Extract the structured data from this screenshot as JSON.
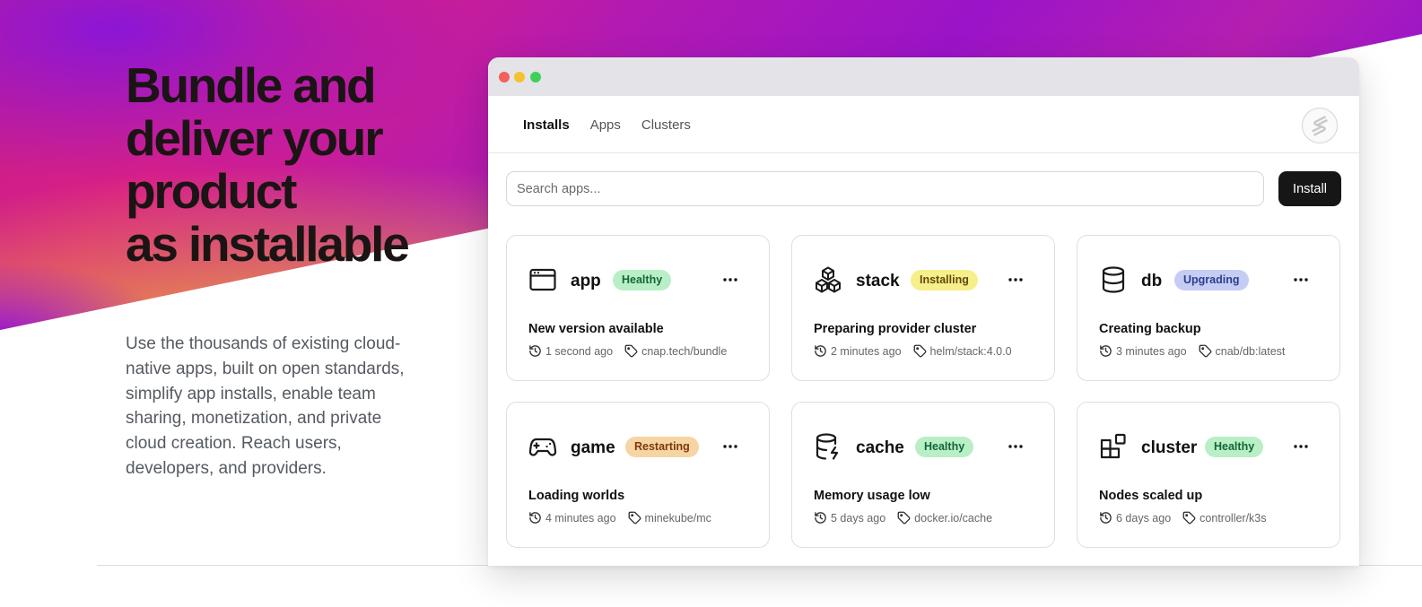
{
  "hero": {
    "title_lines": [
      "Bundle and",
      "deliver your",
      "product",
      "as installable"
    ],
    "description": "Use the thousands of existing cloud-native apps, built on open standards, simplify app installs, enable team sharing, monetization, and private cloud creation. Reach users, developers, and providers."
  },
  "nav": {
    "tabs": [
      {
        "label": "Installs",
        "active": true
      },
      {
        "label": "Apps",
        "active": false
      },
      {
        "label": "Clusters",
        "active": false
      }
    ],
    "avatar_icon": "logo-s-icon"
  },
  "search": {
    "placeholder": "Search apps...",
    "value": ""
  },
  "install_button": {
    "label": "Install"
  },
  "cards": [
    {
      "name": "app",
      "icon": "browser-window-icon",
      "badge": "Healthy",
      "status": "New version available",
      "time": "1 second ago",
      "tag": "cnap.tech/bundle"
    },
    {
      "name": "stack",
      "icon": "cubes-stack-icon",
      "badge": "Installing",
      "status": "Preparing provider cluster",
      "time": "2 minutes ago",
      "tag": "helm/stack:4.0.0"
    },
    {
      "name": "db",
      "icon": "database-icon",
      "badge": "Upgrading",
      "status": "Creating backup",
      "time": "3 minutes ago",
      "tag": "cnab/db:latest"
    },
    {
      "name": "game",
      "icon": "gamepad-icon",
      "badge": "Restarting",
      "status": "Loading worlds",
      "time": "4 minutes ago",
      "tag": "minekube/mc"
    },
    {
      "name": "cache",
      "icon": "database-zap-icon",
      "badge": "Healthy",
      "status": "Memory usage low",
      "time": "5 days ago",
      "tag": "docker.io/cache"
    },
    {
      "name": "cluster",
      "icon": "blocks-icon",
      "badge": "Healthy",
      "status": "Nodes scaled up",
      "time": "6 days ago",
      "tag": "controller/k3s"
    }
  ],
  "badge_colors": {
    "Healthy": {
      "bg": "#b8efc6",
      "fg": "#166534"
    },
    "Installing": {
      "bg": "#f6ef8a",
      "fg": "#614a0a"
    },
    "Upgrading": {
      "bg": "#c5cdf5",
      "fg": "#2f3d8f"
    },
    "Restarting": {
      "bg": "#f7d4a3",
      "fg": "#7c3a0a"
    }
  },
  "brand_colors": {
    "gradient_magenta": "#d81f86",
    "gradient_purple": "#9a12c8",
    "gradient_orange": "#f2a03a",
    "gradient_yellow": "#f4c23c",
    "button_dark": "#161616"
  }
}
